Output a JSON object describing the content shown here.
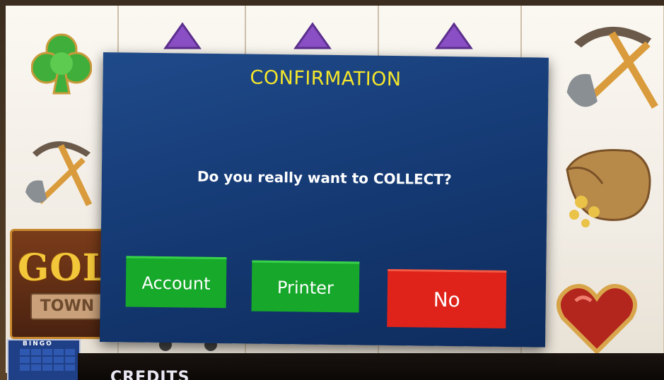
{
  "dialog": {
    "title": "CONFIRMATION",
    "message": "Do you really want to COLLECT?",
    "buttons": {
      "account": "Account",
      "printer": "Printer",
      "no": "No"
    }
  },
  "game": {
    "logo_top": "GOLD",
    "logo_bottom": "TOWN",
    "bingo_label": "BINGO",
    "bottom_label": "CREDITS"
  },
  "icons": [
    "club-icon",
    "pickaxe-icon",
    "diamond-icon",
    "gold-bag-icon",
    "heart-icon",
    "mine-cart-icon"
  ],
  "colors": {
    "dialog_bg": "#143871",
    "title": "#f4e62b",
    "account_button": "#16a92a",
    "printer_button": "#17a82b",
    "no_button": "#e0231a"
  }
}
